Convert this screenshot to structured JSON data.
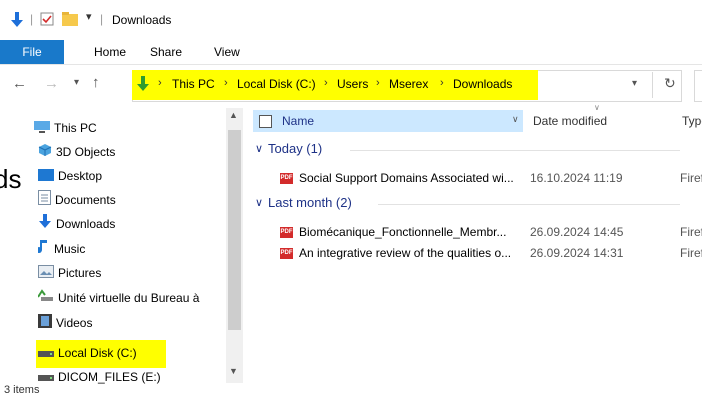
{
  "window": {
    "title": "Downloads"
  },
  "ribbon": {
    "tabs": [
      "File",
      "Home",
      "Share",
      "View"
    ]
  },
  "address": {
    "breadcrumbs": [
      "This PC",
      "Local Disk (C:)",
      "Users",
      "Mserex",
      "Downloads"
    ]
  },
  "nav": {
    "items": [
      {
        "label": "This PC",
        "icon": "monitor-icon"
      },
      {
        "label": "3D Objects",
        "icon": "cube-icon"
      },
      {
        "label": "Desktop",
        "icon": "desktop-icon"
      },
      {
        "label": "Documents",
        "icon": "document-icon"
      },
      {
        "label": "Downloads",
        "icon": "download-arrow-icon"
      },
      {
        "label": "Music",
        "icon": "music-note-icon"
      },
      {
        "label": "Pictures",
        "icon": "pictures-icon"
      },
      {
        "label": "Unité virtuelle du Bureau à",
        "icon": "network-drive-icon"
      },
      {
        "label": "Videos",
        "icon": "film-icon"
      },
      {
        "label": "Local Disk (C:)",
        "icon": "disk-icon"
      },
      {
        "label": "DICOM_FILES (E:)",
        "icon": "disk-icon"
      }
    ]
  },
  "columns": {
    "name": "Name",
    "date": "Date modified",
    "type": "Type"
  },
  "groups": [
    {
      "label": "Today (1)",
      "files": [
        {
          "name": "Social Support Domains Associated wi...",
          "date": "16.10.2024 11:19",
          "type": "Firef"
        }
      ]
    },
    {
      "label": "Last month (2)",
      "files": [
        {
          "name": "Biomécanique_Fonctionnelle_Membr...",
          "date": "26.09.2024 14:45",
          "type": "Firef"
        },
        {
          "name": "An integrative review of the qualities o...",
          "date": "26.09.2024 14:31",
          "type": "Firef"
        }
      ]
    }
  ],
  "status": {
    "items": "3 items"
  },
  "overlay": {
    "partial_text": "ds"
  },
  "colors": {
    "highlight": "#ffff00",
    "accent": "#1979ca",
    "header_hover": "#cce8ff"
  }
}
